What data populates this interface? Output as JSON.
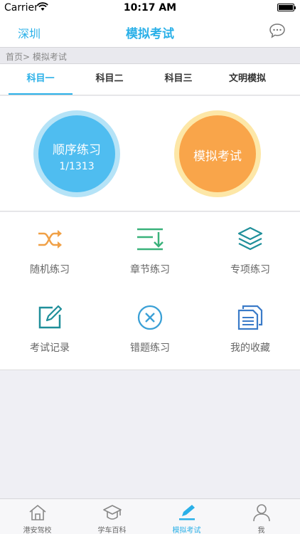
{
  "status_bar": {
    "carrier": "Carrier",
    "time": "10:17 AM"
  },
  "nav": {
    "city": "深圳",
    "title": "模拟考试",
    "right_icon": "chat-bubble-icon"
  },
  "breadcrumb": "首页> 模拟考试",
  "tabs": [
    {
      "label": "科目一",
      "active": true
    },
    {
      "label": "科目二",
      "active": false
    },
    {
      "label": "科目三",
      "active": false
    },
    {
      "label": "文明模拟",
      "active": false
    }
  ],
  "hero": {
    "practice": {
      "label": "顺序练习",
      "progress": "1/1313"
    },
    "exam": {
      "label": "模拟考试"
    }
  },
  "grid": [
    {
      "label": "随机练习",
      "icon": "shuffle-icon"
    },
    {
      "label": "章节练习",
      "icon": "chapter-list-icon"
    },
    {
      "label": "专项练习",
      "icon": "layers-icon"
    },
    {
      "label": "考试记录",
      "icon": "edit-record-icon"
    },
    {
      "label": "错题练习",
      "icon": "wrong-answer-icon"
    },
    {
      "label": "我的收藏",
      "icon": "favorites-document-icon"
    }
  ],
  "tabbar": [
    {
      "label": "港安驾校",
      "icon": "home-icon",
      "active": false
    },
    {
      "label": "学车百科",
      "icon": "graduation-cap-icon",
      "active": false
    },
    {
      "label": "模拟考试",
      "icon": "pen-icon",
      "active": true
    },
    {
      "label": "我",
      "icon": "user-icon",
      "active": false
    }
  ],
  "colors": {
    "accent": "#2ab0e8",
    "practice_circle": "#4fbdf0",
    "exam_circle": "#f9a54a"
  }
}
